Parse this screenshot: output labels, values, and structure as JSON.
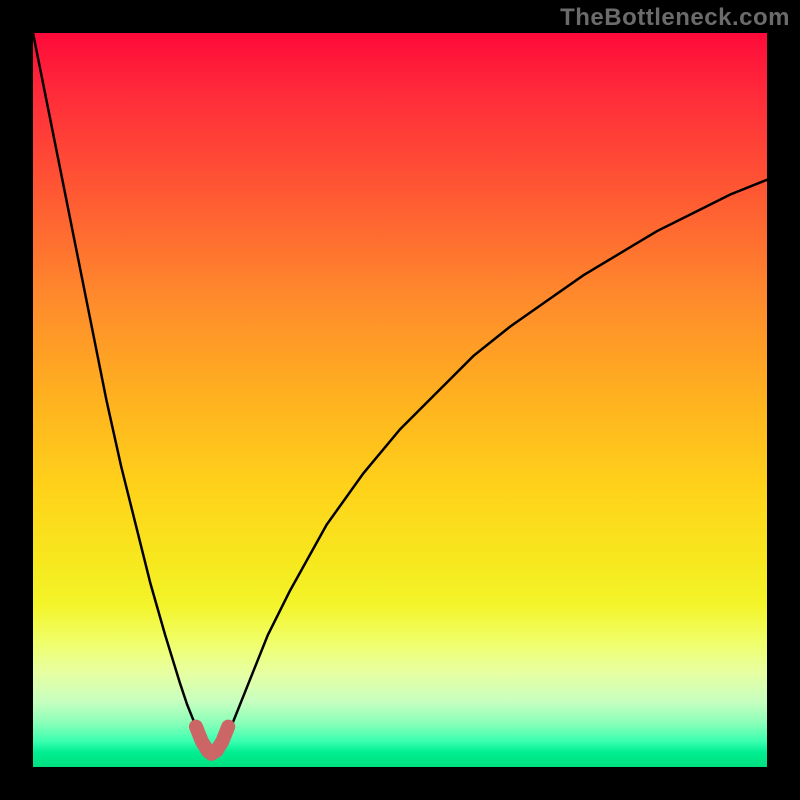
{
  "watermark": "TheBottleneck.com",
  "colors": {
    "frame": "#000000",
    "curve": "#000000",
    "emphasis": "#cc6666",
    "gradient_top": "#ff0a3a",
    "gradient_bottom": "#00e07e"
  },
  "chart_data": {
    "type": "line",
    "title": "",
    "xlabel": "",
    "ylabel": "",
    "xlim": [
      0,
      100
    ],
    "ylim": [
      0,
      100
    ],
    "grid": false,
    "series": [
      {
        "name": "bottleneck-curve",
        "x": [
          0,
          2,
          4,
          6,
          8,
          10,
          12,
          14,
          16,
          18,
          20,
          21,
          22,
          22.5,
          23,
          23.5,
          24,
          24.5,
          25,
          25.5,
          26,
          27,
          28,
          30,
          32,
          35,
          40,
          45,
          50,
          55,
          60,
          65,
          70,
          75,
          80,
          85,
          90,
          95,
          100
        ],
        "y": [
          100,
          90,
          80,
          70,
          60,
          50,
          41,
          33,
          25,
          18,
          11.5,
          8.5,
          6,
          4.5,
          3.2,
          2.3,
          1.8,
          1.6,
          1.8,
          2.3,
          3.2,
          5.5,
          8,
          13,
          18,
          24,
          33,
          40,
          46,
          51,
          56,
          60,
          63.5,
          67,
          70,
          73,
          75.5,
          78,
          80
        ]
      },
      {
        "name": "emphasis-zone",
        "x": [
          22.2,
          23.0,
          23.8,
          24.3,
          25.0,
          25.8,
          26.6
        ],
        "y": [
          5.5,
          3.5,
          2.2,
          1.8,
          2.2,
          3.5,
          5.5
        ]
      }
    ],
    "minimum_x": 24.3,
    "minimum_y": 1.6
  }
}
